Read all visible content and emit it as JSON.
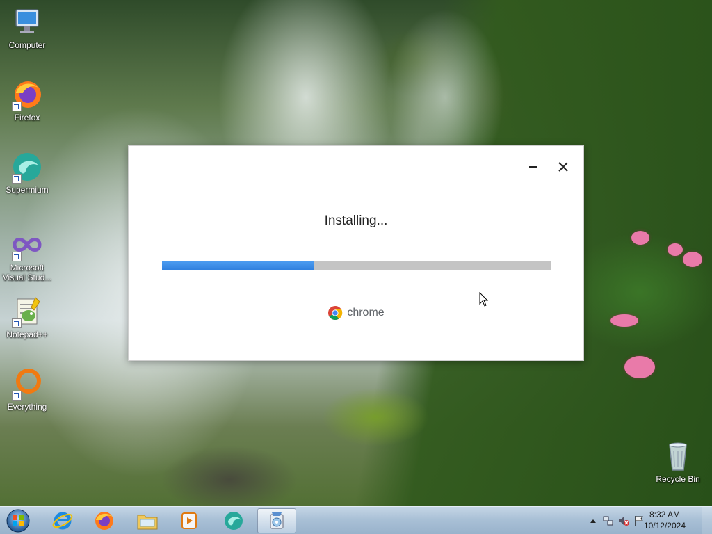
{
  "desktop": {
    "icons": [
      {
        "label": "Computer",
        "icon": "computer-icon"
      },
      {
        "label": "Firefox",
        "icon": "firefox-icon"
      },
      {
        "label": "Supermium",
        "icon": "supermium-icon"
      },
      {
        "label": "Microsoft Visual Stud...",
        "icon": "visual-studio-icon"
      },
      {
        "label": "Notepad++",
        "icon": "notepad-plus-plus-icon"
      },
      {
        "label": "Everything",
        "icon": "everything-icon"
      },
      {
        "label": "Recycle Bin",
        "icon": "recycle-bin-icon"
      }
    ]
  },
  "installer": {
    "status": "Installing...",
    "progress": 0.39,
    "brand": "chrome",
    "minimize_icon": "minimize-icon",
    "close_icon": "close-icon",
    "colors": {
      "progress_fill": "#3388e6",
      "progress_track": "#c4c4c4"
    }
  },
  "taskbar": {
    "start_icon": "windows-start-icon",
    "pinned": [
      {
        "name": "internet-explorer",
        "icon": "internet-explorer-icon"
      },
      {
        "name": "firefox",
        "icon": "firefox-icon"
      },
      {
        "name": "file-explorer",
        "icon": "folder-icon"
      },
      {
        "name": "media-player",
        "icon": "media-player-icon"
      },
      {
        "name": "supermium",
        "icon": "supermium-icon"
      },
      {
        "name": "installer",
        "icon": "installer-icon",
        "active": true
      }
    ],
    "tray": {
      "show_hidden_icon": "chevron-up-icon",
      "network_icon": "network-icon",
      "volume_icon": "volume-muted-icon",
      "action_center_icon": "flag-icon",
      "time": "8:32 AM",
      "date": "10/12/2024"
    }
  }
}
